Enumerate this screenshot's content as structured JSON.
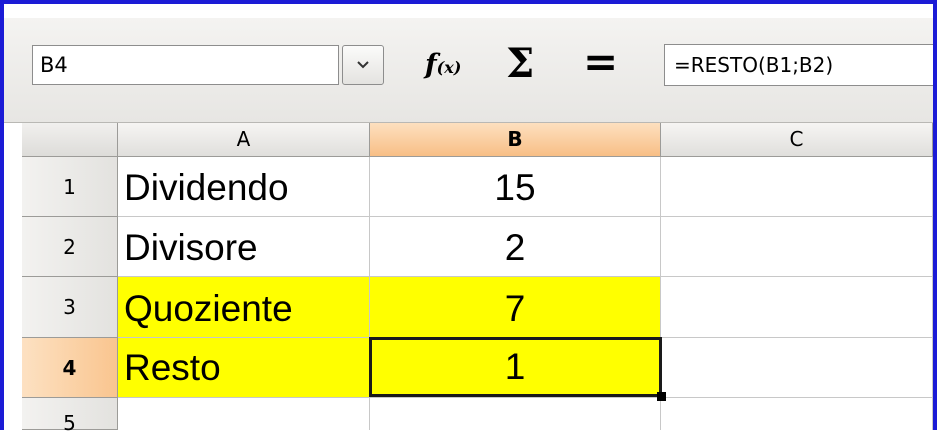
{
  "formula_bar": {
    "name_box": "B4",
    "function_wizard_icon": "f(x)",
    "sum_icon": "Σ",
    "equals_icon": "=",
    "formula": "=RESTO(B1;B2)"
  },
  "columns": [
    "A",
    "B",
    "C"
  ],
  "active_column": "B",
  "rows": [
    {
      "number": "1",
      "a": "Dividendo",
      "b": "15",
      "c": ""
    },
    {
      "number": "2",
      "a": "Divisore",
      "b": "2",
      "c": ""
    },
    {
      "number": "3",
      "a": "Quoziente",
      "b": "7",
      "c": ""
    },
    {
      "number": "4",
      "a": "Resto",
      "b": "1",
      "c": ""
    },
    {
      "number": "5",
      "a": "",
      "b": "",
      "c": ""
    }
  ],
  "active_row": "4",
  "colors": {
    "highlight": "#ffff00",
    "header_active": "#f8bf86",
    "frame": "#1b1bd6"
  }
}
